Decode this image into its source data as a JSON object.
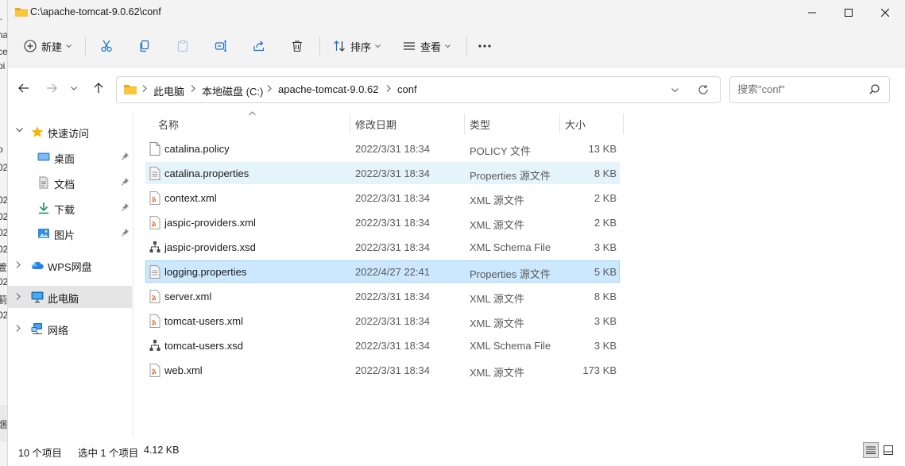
{
  "window": {
    "title": "C:\\apache-tomcat-9.0.62\\conf"
  },
  "toolbar": {
    "new_label": "新建",
    "sort_label": "排序",
    "view_label": "查看"
  },
  "address": {
    "crumbs": [
      "此电脑",
      "本地磁盘 (C:)",
      "apache-tomcat-9.0.62",
      "conf"
    ]
  },
  "search": {
    "placeholder": "搜索\"conf\""
  },
  "nav": {
    "quick_access": "快速访问",
    "desktop": "桌面",
    "documents": "文档",
    "downloads": "下载",
    "pictures": "图片",
    "wps": "WPS网盘",
    "this_pc": "此电脑",
    "network": "网络"
  },
  "columns": {
    "name": "名称",
    "date": "修改日期",
    "type": "类型",
    "size": "大小"
  },
  "files": [
    {
      "name": "catalina.policy",
      "date": "2022/3/31 18:34",
      "type": "POLICY 文件",
      "size": "13 KB",
      "icon": "document-icon"
    },
    {
      "name": "catalina.properties",
      "date": "2022/3/31 18:34",
      "type": "Properties 源文件",
      "size": "8 KB",
      "icon": "properties-file-icon"
    },
    {
      "name": "context.xml",
      "date": "2022/3/31 18:34",
      "type": "XML 源文件",
      "size": "2 KB",
      "icon": "xml-file-icon"
    },
    {
      "name": "jaspic-providers.xml",
      "date": "2022/3/31 18:34",
      "type": "XML 源文件",
      "size": "2 KB",
      "icon": "xml-file-icon"
    },
    {
      "name": "jaspic-providers.xsd",
      "date": "2022/3/31 18:34",
      "type": "XML Schema File",
      "size": "3 KB",
      "icon": "schema-file-icon"
    },
    {
      "name": "logging.properties",
      "date": "2022/4/27 22:41",
      "type": "Properties 源文件",
      "size": "5 KB",
      "icon": "properties-file-icon"
    },
    {
      "name": "server.xml",
      "date": "2022/3/31 18:34",
      "type": "XML 源文件",
      "size": "8 KB",
      "icon": "xml-file-icon"
    },
    {
      "name": "tomcat-users.xml",
      "date": "2022/3/31 18:34",
      "type": "XML 源文件",
      "size": "3 KB",
      "icon": "xml-file-icon"
    },
    {
      "name": "tomcat-users.xsd",
      "date": "2022/3/31 18:34",
      "type": "XML Schema File",
      "size": "3 KB",
      "icon": "schema-file-icon"
    },
    {
      "name": "web.xml",
      "date": "2022/3/31 18:34",
      "type": "XML 源文件",
      "size": "173 KB",
      "icon": "xml-file-icon"
    }
  ],
  "status": {
    "count": "10 个项目",
    "selected": "选中 1 个项目",
    "selected_size": "4.12 KB"
  },
  "colors": {
    "selection": "#cce8ff",
    "hover": "#e5f3fb",
    "folder": "#f8c83c",
    "accent": "#0067c0"
  }
}
